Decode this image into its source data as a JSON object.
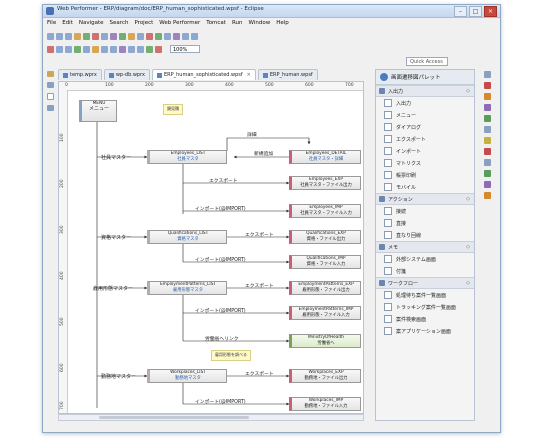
{
  "window": {
    "title": "Web Performer - ERP/diagram/doc/ERP_human_sophisticated.wpsf - Eclipse"
  },
  "menubar": [
    "File",
    "Edit",
    "Navigate",
    "Search",
    "Project",
    "Web Performer",
    "Tomcat",
    "Run",
    "Window",
    "Help"
  ],
  "toolbar": {
    "zoom": "100%"
  },
  "quick_access": "Quick Access",
  "tabs": [
    {
      "label": "temp.wprx",
      "active": false
    },
    {
      "label": "wp-db.wprx",
      "active": false
    },
    {
      "label": "ERP_human_sophisticated.wpsf",
      "active": true
    },
    {
      "label": "ERP_human.wpsf",
      "active": false
    }
  ],
  "ruler": {
    "h": [
      "0",
      "100",
      "200",
      "300",
      "400",
      "500",
      "600",
      "700"
    ],
    "v": [
      "100",
      "200",
      "300",
      "400",
      "500",
      "600",
      "700"
    ]
  },
  "diagram": {
    "menu": {
      "en": "MENU",
      "jp": "メニュー"
    },
    "note_top": "類見積",
    "note_middle": "雇用形態を調べる",
    "nodes": [
      {
        "id": "emp_list",
        "en": "Employees_LIST",
        "jp": "社員マスタ"
      },
      {
        "id": "emp_detail",
        "en": "Employees_DETAIL",
        "jp": "社員マスタ・詳細"
      },
      {
        "id": "emp_exp",
        "en": "Employees_EXP",
        "jp": "社員マスタ・ファイル出力"
      },
      {
        "id": "emp_imp",
        "en": "Employees_IMP",
        "jp": "社員マスタ・ファイル入力"
      },
      {
        "id": "qual_list",
        "en": "Qualifications_LIST",
        "jp": "資格マスタ"
      },
      {
        "id": "qual_exp",
        "en": "Qualifications_EXP",
        "jp": "資格・ファイル出力"
      },
      {
        "id": "qual_imp",
        "en": "Qualifications_IMP",
        "jp": "資格・ファイル入力"
      },
      {
        "id": "ep_list",
        "en": "EmploymentPatterns_LIST",
        "jp": "雇用形態マスタ"
      },
      {
        "id": "ep_exp",
        "en": "EmploymentPatterns_EXP",
        "jp": "雇用形態・ファイル出力"
      },
      {
        "id": "ep_imp",
        "en": "EmploymentPatterns_IMP",
        "jp": "雇用形態・ファイル入力"
      },
      {
        "id": "mhlw",
        "en": "MinistryOfHealth",
        "jp": "労働省へ"
      },
      {
        "id": "wp_list",
        "en": "Workplaces_LIST",
        "jp": "勤務地マスタ"
      },
      {
        "id": "wp_exp",
        "en": "Workplaces_EXP",
        "jp": "勤務地・ファイル出力"
      },
      {
        "id": "wp_imp",
        "en": "Workplaces_IMP",
        "jp": "勤務地・ファイル入力"
      }
    ],
    "edges": {
      "detail": "詳細",
      "new_add": "新規追加",
      "export": "エクスポート",
      "import": "インポート(@IMPORT)",
      "to_mhlw": "労働省へリンク"
    },
    "rows": [
      "社員マスター",
      "資格マスター",
      "雇用形態マスター",
      "勤務地マスター"
    ]
  },
  "palette": {
    "title": "画面遷移図パレット",
    "sections": [
      {
        "label": "入出力",
        "items": [
          "入出力",
          "メニュー",
          "ダイアログ",
          "エクスポート",
          "インポート",
          "マトリクス",
          "帳票印刷",
          "モバイル"
        ]
      },
      {
        "label": "アクション",
        "items": [
          "接続",
          "直接",
          "直なり回線"
        ]
      },
      {
        "label": "メモ",
        "items": [
          "外部システム画面",
          "付箋"
        ]
      },
      {
        "label": "ワークフロー",
        "items": [
          "処理待ち案件一覧画面",
          "トラッキング案件一覧画面",
          "案件検索画面",
          "案アプリケーション画面"
        ]
      }
    ]
  }
}
